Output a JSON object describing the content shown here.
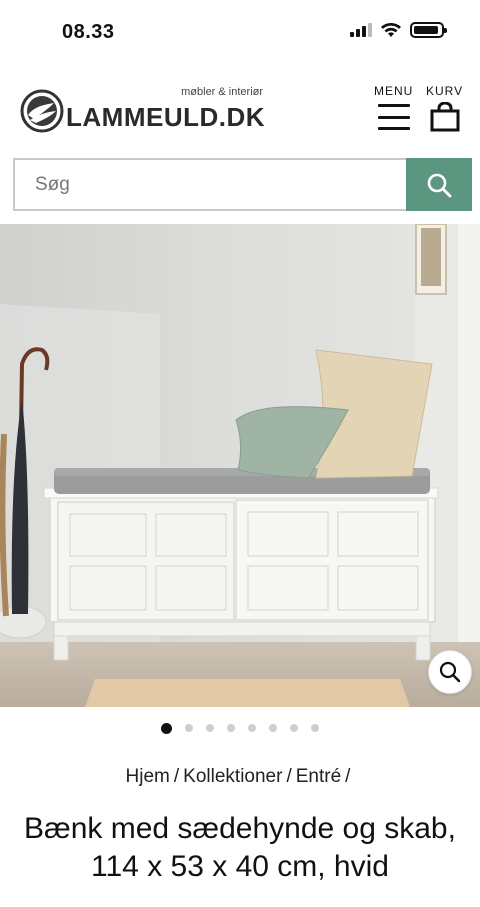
{
  "status_bar": {
    "time": "08.33",
    "icons": [
      "signal-icon",
      "wifi-icon",
      "battery-icon"
    ]
  },
  "header": {
    "logo": {
      "name": "LAMMEULD.DK",
      "tagline": "møbler & interiør"
    },
    "menu_label": "MENU",
    "cart_label": "KURV"
  },
  "search": {
    "placeholder": "Søg",
    "value": "",
    "button_icon": "search-icon"
  },
  "gallery": {
    "total_images": 8,
    "active_index": 0,
    "zoom_icon": "zoom-icon"
  },
  "breadcrumb": {
    "items": [
      "Hjem",
      "Kollektioner",
      "Entré"
    ],
    "separator": "/"
  },
  "product": {
    "title": "Bænk med sædehynde og skab, 114 x 53 x 40 cm, hvid"
  },
  "colors": {
    "accent": "#5a9680",
    "text": "#111111",
    "border": "#c9c9c9",
    "dot_inactive": "#cfcfcf"
  }
}
